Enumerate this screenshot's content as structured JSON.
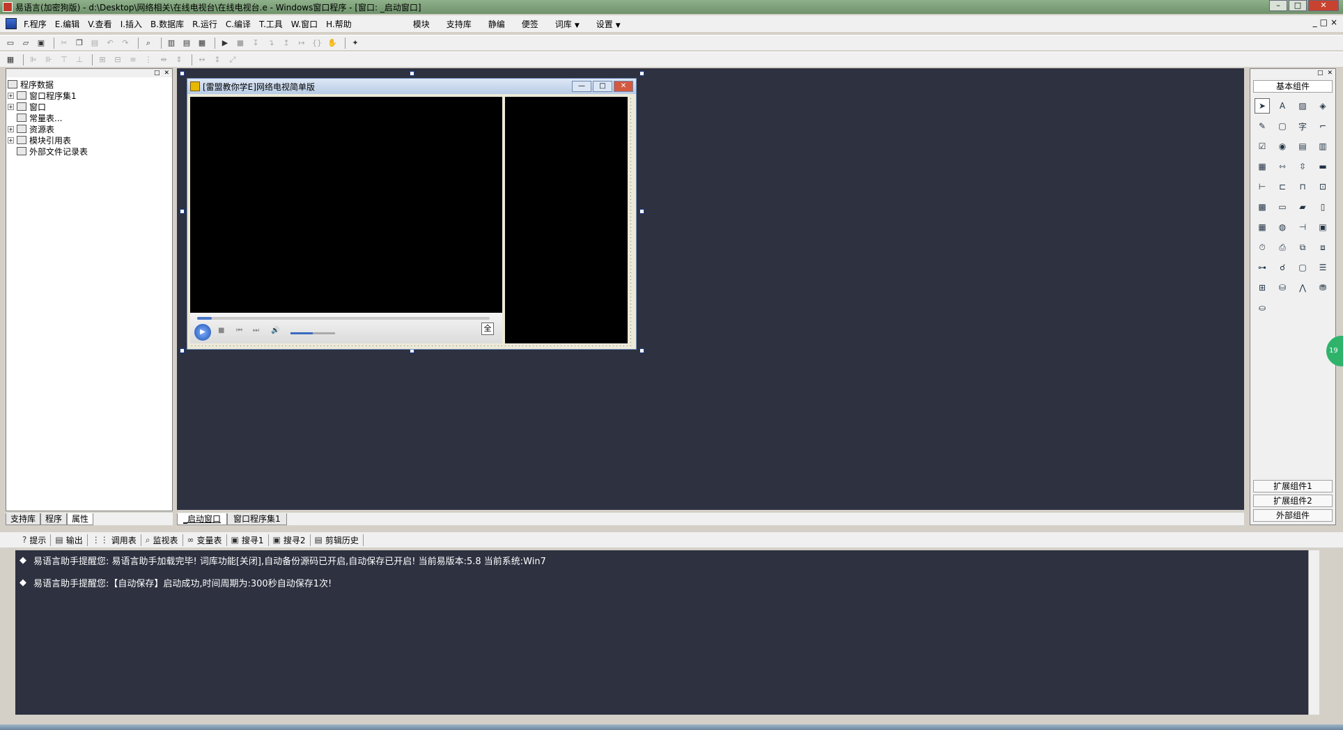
{
  "window": {
    "title": "易语言(加密狗版) - d:\\Desktop\\网络相关\\在线电视台\\在线电视台.e - Windows窗口程序 - [窗口: _启动窗口]",
    "controls": [
      "–",
      "□",
      "✕"
    ]
  },
  "menu": {
    "items": [
      "F.程序",
      "E.编辑",
      "V.查看",
      "I.插入",
      "B.数据库",
      "R.运行",
      "C.编译",
      "T.工具",
      "W.窗口",
      "H.帮助"
    ],
    "extra": [
      "模块",
      "支持库",
      "静编",
      "便签",
      "词库",
      "设置"
    ],
    "right_controls": [
      "_",
      "□",
      "×"
    ]
  },
  "left_panel": {
    "tree": [
      "程序数据",
      "窗口程序集1",
      "窗口",
      "常量表...",
      "资源表",
      "模块引用表",
      "外部文件记录表"
    ],
    "tabs": [
      "支持库",
      "程序",
      "属性"
    ]
  },
  "form": {
    "title": "[雷盟教你学E]网络电视简单版",
    "buttons": [
      "—",
      "□",
      "✕"
    ],
    "full_label": "全",
    "seek_progress": 0.05,
    "volume_level": 0.5
  },
  "right_panel": {
    "title": "基本组件",
    "bottom": [
      "扩展组件1",
      "扩展组件2",
      "外部组件"
    ]
  },
  "doc_tabs": [
    "_启动窗口",
    "窗口程序集1"
  ],
  "bottom_tabs": [
    "提示",
    "输出",
    "调用表",
    "监视表",
    "变量表",
    "搜寻1",
    "搜寻2",
    "剪辑历史"
  ],
  "output": {
    "lines": [
      "易语言助手提醒您:  易语言助手加载完毕!  词库功能[关闭],自动备份源码已开启,自动保存已开启!  当前易版本:5.8  当前系统:Win7",
      "易语言助手提醒您:【自动保存】启动成功,时间周期为:300秒自动保存1次!"
    ]
  },
  "badge": "19"
}
